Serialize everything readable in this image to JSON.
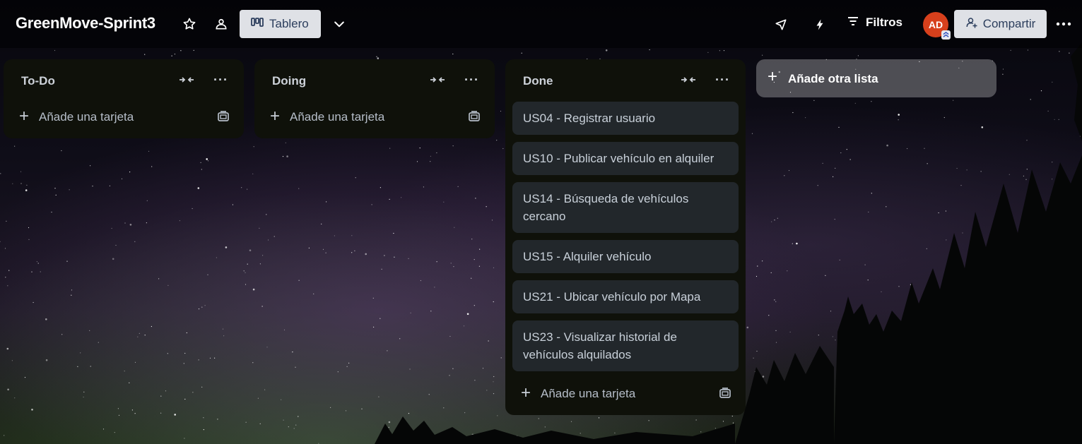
{
  "board": {
    "title": "GreenMove-Sprint3",
    "view_label": "Tablero"
  },
  "header": {
    "filters_label": "Filtros",
    "avatar_initials": "AD",
    "share_label": "Compartir"
  },
  "lists": [
    {
      "title": "To-Do",
      "cards": [],
      "add_card_label": "Añade una tarjeta"
    },
    {
      "title": "Doing",
      "cards": [],
      "add_card_label": "Añade una tarjeta"
    },
    {
      "title": "Done",
      "cards": [
        "US04 - Registrar usuario",
        "US10 - Publicar vehículo en alquiler",
        "US14 - Búsqueda de vehículos cercano",
        "US15 - Alquiler vehículo",
        "US21 - Ubicar vehículo por Mapa",
        "US23 - Visualizar historial de vehículos alquilados"
      ],
      "add_card_label": "Añade una tarjeta"
    }
  ],
  "add_list_label": "Añade otra lista",
  "colors": {
    "avatar": "#d7401c",
    "list_bg": "#0f110a",
    "card_bg": "#22272b",
    "button_bg": "#dfe1e6"
  }
}
